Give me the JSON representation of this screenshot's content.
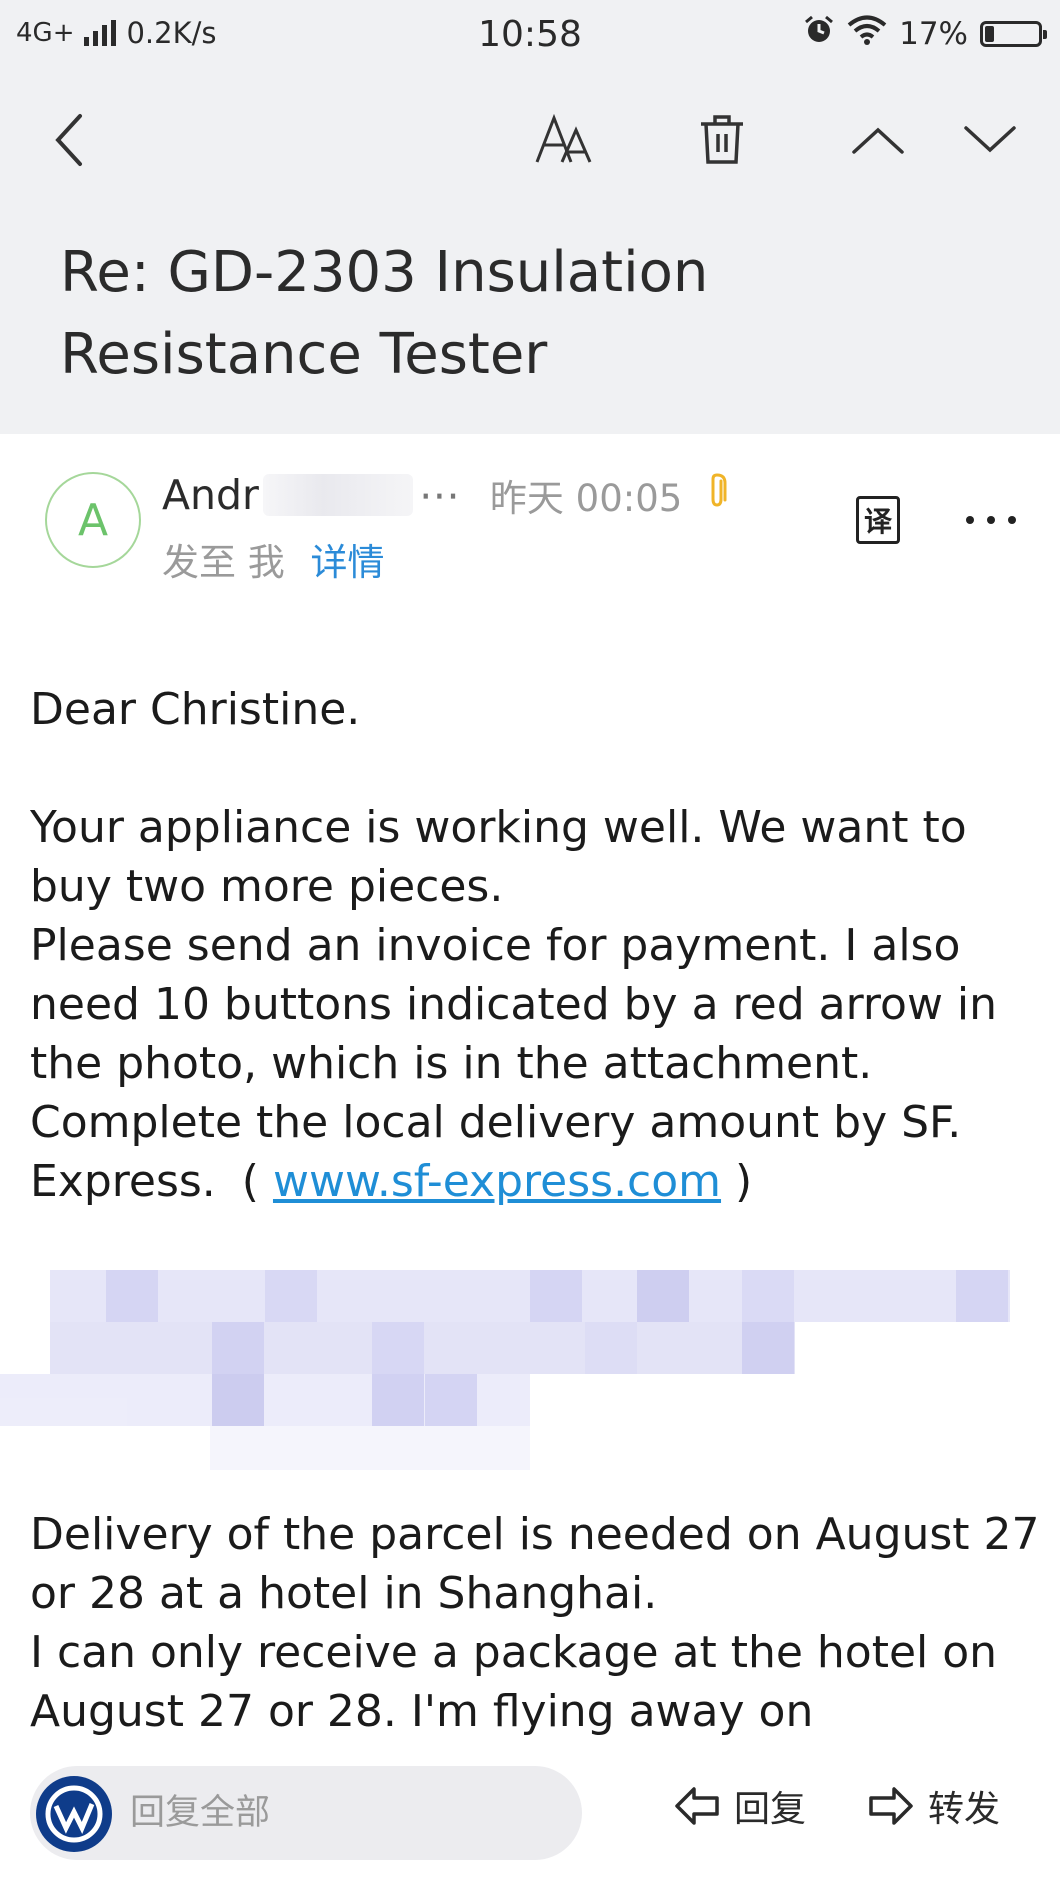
{
  "status_bar": {
    "network": "4G+",
    "speed": "0.2K/s",
    "time": "10:58",
    "battery_percent": "17%",
    "battery_level": 0.17
  },
  "toolbar": {
    "back_icon": "chevron-left-icon",
    "font_icon": "font-size-icon",
    "delete_icon": "trash-icon",
    "prev_icon": "chevron-up-icon",
    "next_icon": "chevron-down-icon"
  },
  "email": {
    "subject": "Re: GD-2303 Insulation Resistance Tester",
    "sender_initial": "A",
    "sender_name": "Andr",
    "sender_ellipsis": "⋯",
    "time": "昨天 00:05",
    "recipient": "发至 我",
    "details": "详情",
    "translate_label": "译"
  },
  "body": {
    "greeting": "Dear  Christine.",
    "para1": "Your appliance is working well. We want to buy two more pieces.",
    "para2": "Please send an invoice for payment. I also need 10 buttons indicated by a red arrow in the photo, which is in the attachment.",
    "para3_text": "Complete the local delivery amount by SF. Express.",
    "para3_open": "(",
    "para3_link": "www.sf-express.com",
    "para3_close": ")",
    "para4": "Delivery of the parcel is needed on August 27 or 28 at a hotel in Shanghai.",
    "para5": "I can only receive a package at the hotel on August 27 or 28. I'm flying away on"
  },
  "bottom_bar": {
    "reply_all": "回复全部",
    "reply": "回复",
    "forward": "转发"
  },
  "colors": {
    "header_bg": "#f0f1f3",
    "link": "#1f8ed6",
    "avatar_green": "#6cc36b",
    "details_blue": "#2b8bd8"
  }
}
